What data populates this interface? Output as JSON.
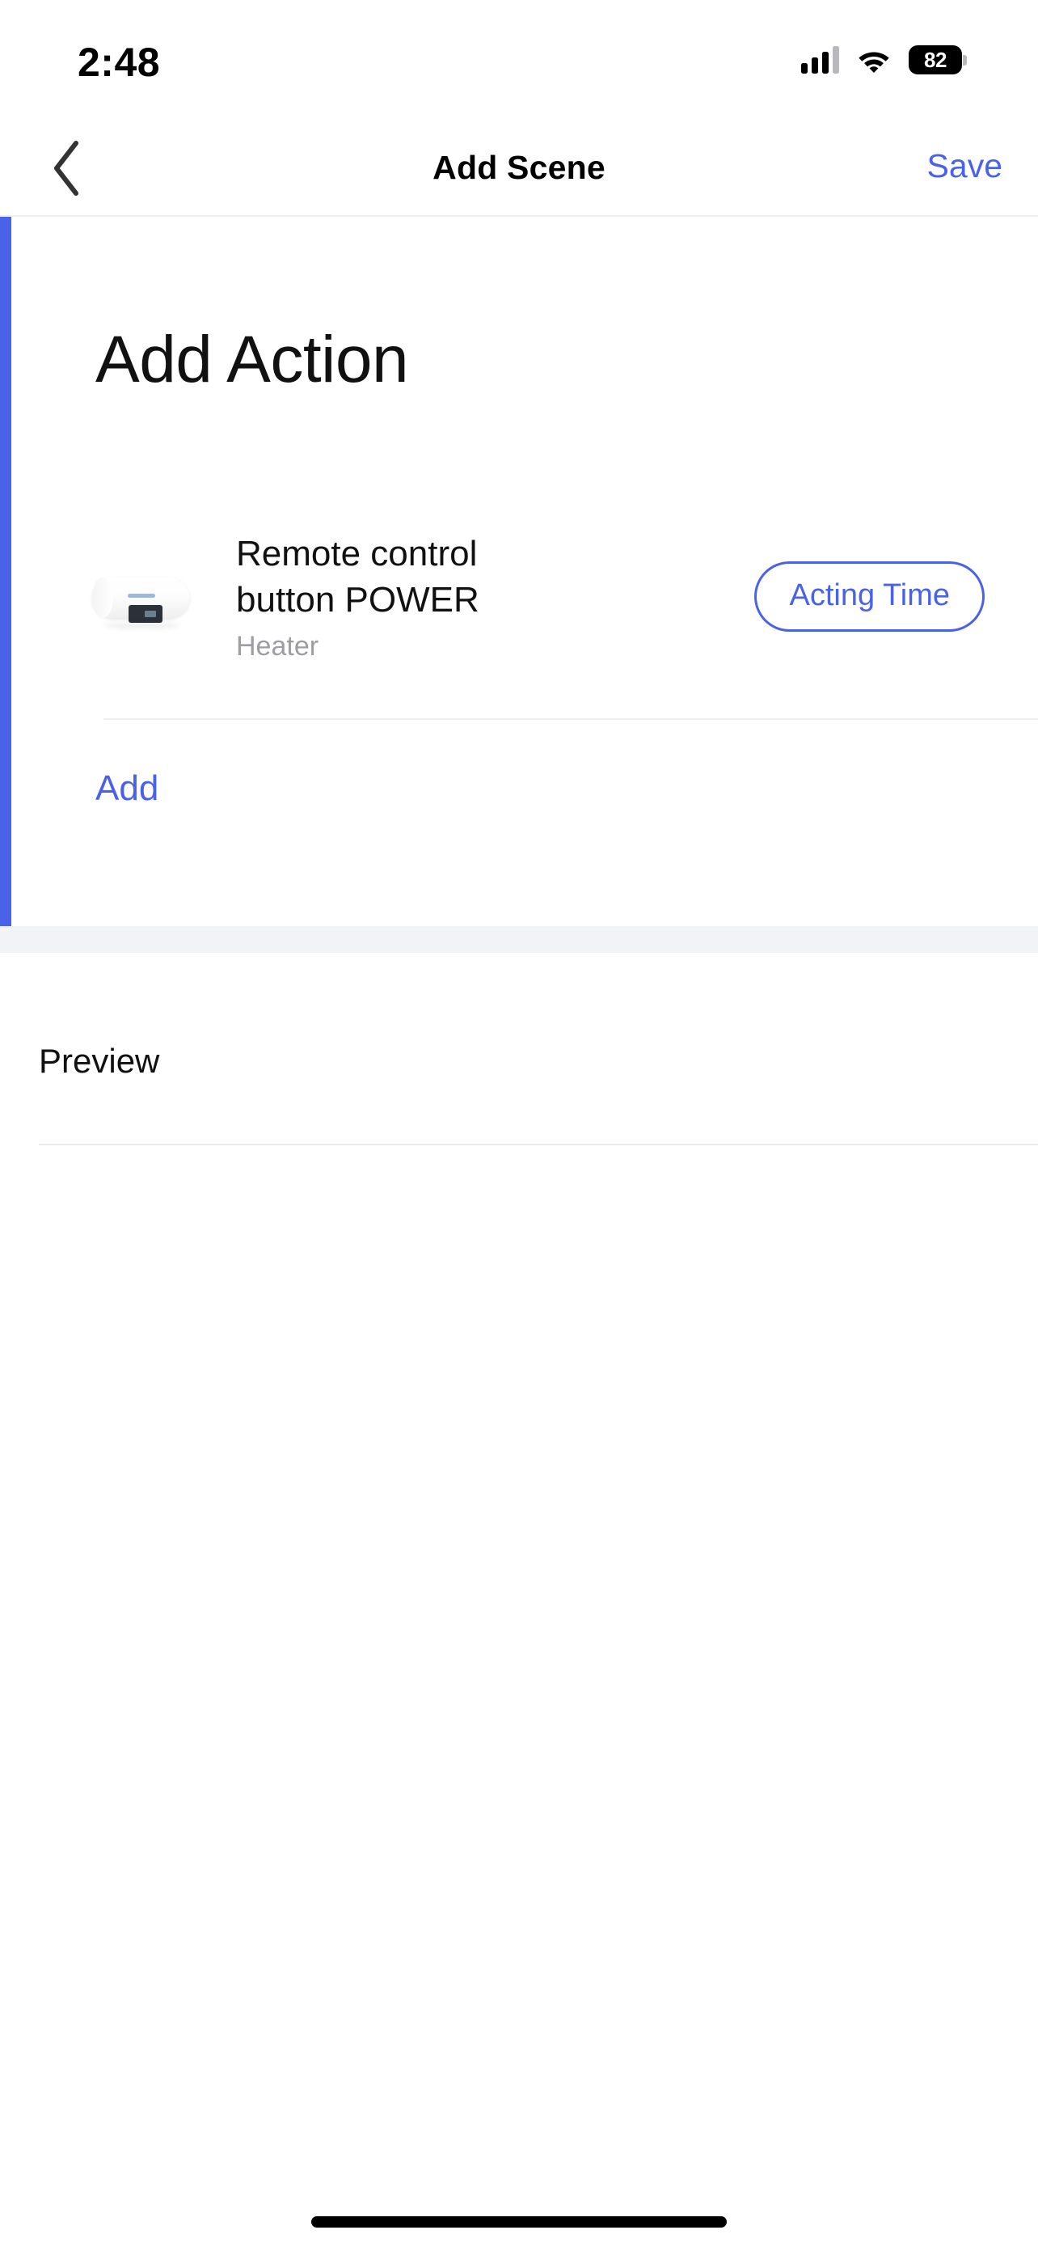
{
  "status_bar": {
    "time": "2:48",
    "battery_percent": "82",
    "cellular_icon": "cellular-signal-icon",
    "wifi_icon": "wifi-icon",
    "battery_icon": "battery-icon"
  },
  "nav_bar": {
    "back_icon": "chevron-left-icon",
    "title": "Add Scene",
    "save_label": "Save"
  },
  "action_section": {
    "heading": "Add Action",
    "rows": [
      {
        "device_icon": "water-heater-icon",
        "title": "Remote control button POWER",
        "subtitle": "Heater",
        "button_label": "Acting Time"
      }
    ],
    "add_label": "Add"
  },
  "preview_section": {
    "label": "Preview"
  },
  "colors": {
    "accent_blue": "#4a62e8",
    "text_primary": "#111111",
    "text_secondary": "#9d9da2",
    "divider": "#eceef0",
    "section_gap": "#f1f3f7",
    "background": "#ffffff"
  }
}
